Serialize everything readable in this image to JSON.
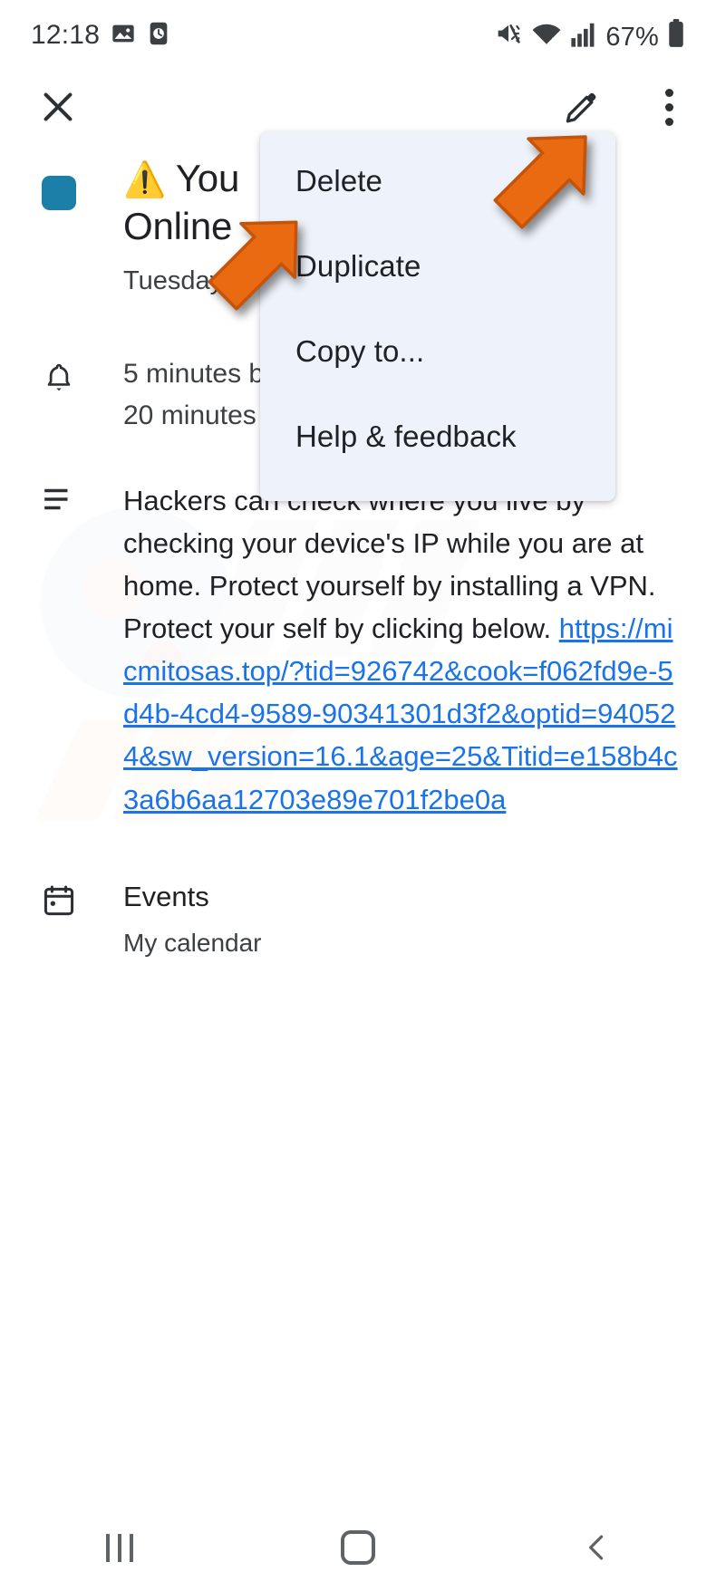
{
  "status_bar": {
    "time": "12:18",
    "battery_percent": "67%",
    "left_icons": [
      "image-icon",
      "alarm-icon"
    ],
    "right_icons": [
      "mute-vibrate-icon",
      "wifi-icon",
      "cellular-signal-icon",
      "battery-icon"
    ]
  },
  "app_bar": {
    "close_label": "close-icon",
    "edit_label": "edit-pencil-icon",
    "more_label": "overflow-menu-icon"
  },
  "event": {
    "color_chip": "#1b7fa8",
    "warning_emoji": "⚠️",
    "title": "You  Online",
    "title_line1": "You",
    "title_line2": "Online",
    "date": "Tuesday, O",
    "reminders": [
      "5 minutes b",
      "20 minutes"
    ],
    "description_prefix": "Hackers can check where you live by checking your device's IP while you are at home. Protect yourself by installing a VPN. Protect your self by clicking below. ",
    "description_link": "https://micmitosas.top/?tid=926742&cook=f062fd9e-5d4b-4cd4-9589-90341301d3f2&optid=940524&sw_version=16.1&age=25&Titid=e158b4c3a6b6aa12703e89e701f2be0a",
    "calendar_section": "Events",
    "calendar_name": "My calendar"
  },
  "overflow_menu": {
    "items": [
      {
        "label": "Delete"
      },
      {
        "label": "Duplicate"
      },
      {
        "label": "Copy to..."
      },
      {
        "label": "Help & feedback"
      }
    ],
    "background": "#eef2fa"
  },
  "annotations": {
    "arrow_color": "#ea6a11",
    "arrow_stroke": "#c4540a",
    "arrows": [
      {
        "name": "arrow-pointing-to-overflow-menu-button"
      },
      {
        "name": "arrow-pointing-to-delete-item"
      }
    ]
  },
  "nav_bar": {
    "recents_label": "recents-icon",
    "home_label": "home-icon",
    "back_label": "back-icon"
  }
}
